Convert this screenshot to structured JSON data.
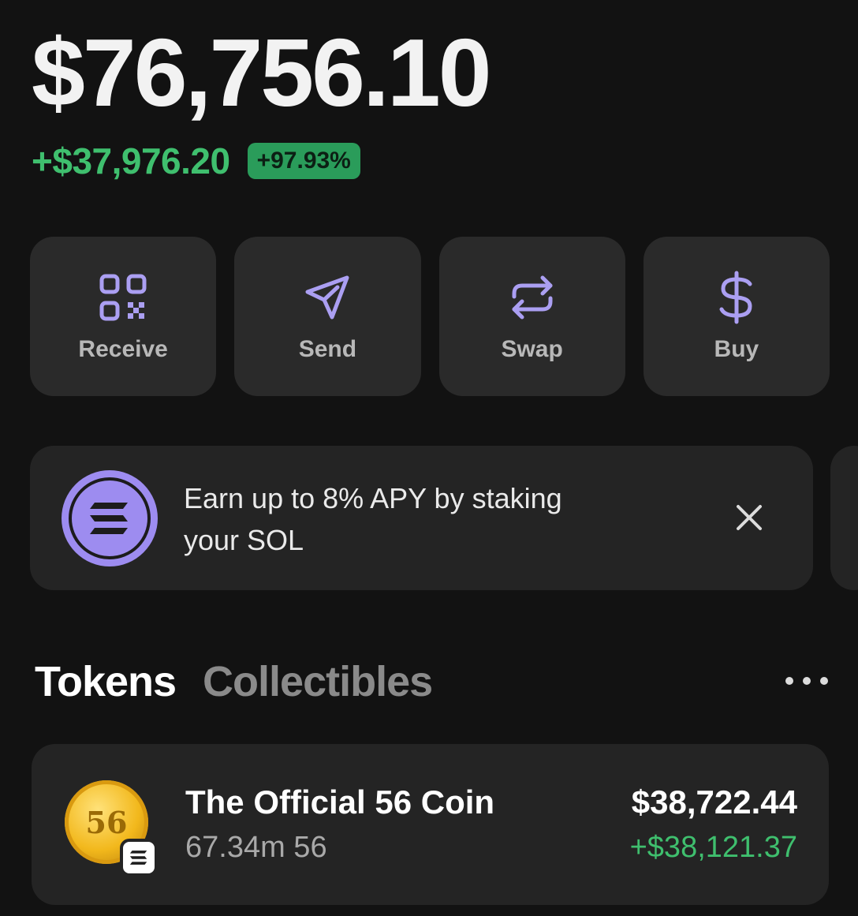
{
  "portfolio": {
    "balance": "$76,756.10",
    "change_amount": "+$37,976.20",
    "change_percent": "+97.93%"
  },
  "actions": [
    {
      "label": "Receive",
      "icon": "qr-code-icon"
    },
    {
      "label": "Send",
      "icon": "send-icon"
    },
    {
      "label": "Swap",
      "icon": "swap-icon"
    },
    {
      "label": "Buy",
      "icon": "dollar-icon"
    }
  ],
  "promo": {
    "text_line1": "Earn up to 8% APY by staking",
    "text_line2": "your SOL",
    "icon": "solana-icon",
    "close_icon": "close-icon"
  },
  "tabs": {
    "active": "Tokens",
    "inactive": "Collectibles",
    "more_icon": "more-icon"
  },
  "tokens": [
    {
      "name": "The Official 56 Coin",
      "balance": "67.34m 56",
      "value": "$38,722.44",
      "change": "+$38,121.37",
      "logo_text": "56",
      "chain_icon": "solana-icon"
    }
  ],
  "colors": {
    "background": "#121212",
    "card": "#2a2a2a",
    "accent_purple": "#ab9ff2",
    "positive_green": "#3fbf6e"
  }
}
